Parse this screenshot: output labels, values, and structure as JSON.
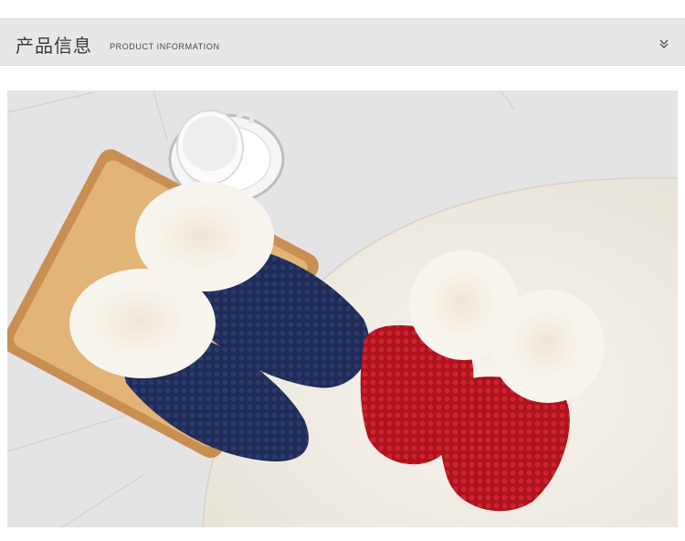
{
  "header": {
    "title_cn": "产品信息",
    "title_en": "PRODUCT INFORMATION",
    "chevron_icon": "double-chevron-down-icon"
  },
  "photo": {
    "subject": "product-photo-slippers",
    "colors": {
      "navy": "#1d2a55",
      "red": "#b8141e",
      "fur": "#f6f2ea",
      "tray": "#dca86d",
      "rug": "#f2efe8"
    }
  }
}
